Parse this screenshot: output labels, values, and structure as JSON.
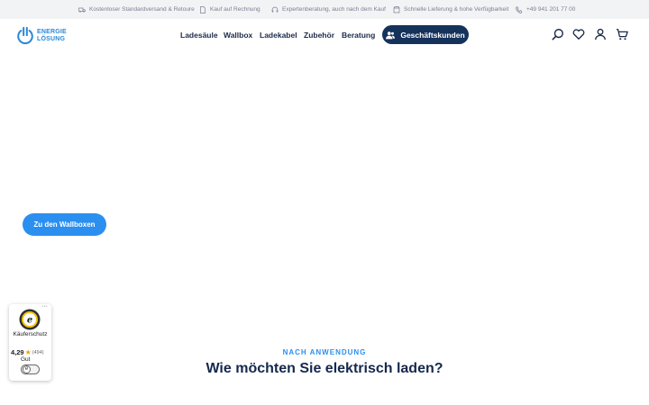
{
  "topbar": {
    "items": [
      {
        "icon": "truck-icon",
        "text": "Kostenloser Standardversand & Retoure"
      },
      {
        "icon": "document-icon",
        "text": "Kauf auf Rechnung"
      },
      {
        "icon": "headset-icon",
        "text": "Expertenberatung, auch nach dem Kauf"
      },
      {
        "icon": "box-icon",
        "text": "Schnelle Lieferung & hohe Verfügbarkeit"
      },
      {
        "icon": "phone-icon",
        "text": "+49 941 201 77 00"
      }
    ]
  },
  "header": {
    "logo_line1": "ENERGIE",
    "logo_line2": "LÖSUNG",
    "nav": [
      "Ladesäule",
      "Wallbox",
      "Ladekabel",
      "Zubehör",
      "Beratung"
    ],
    "business_button": "Geschäftskunden",
    "icons": [
      "search-icon",
      "heart-icon",
      "user-icon",
      "cart-icon"
    ]
  },
  "hero": {
    "cta_label": "Zu den Wallboxen"
  },
  "trust_badge": {
    "label": "Käuferschutz",
    "score": "4,29",
    "count": "(494)",
    "grade": "Gut"
  },
  "section": {
    "eyebrow": "NACH ANWENDUNG",
    "title": "Wie möchten Sie elektrisch laden?"
  },
  "colors": {
    "accent": "#2b8ff0",
    "navy": "#15325b",
    "topbar_bg": "#f2f3f5"
  }
}
